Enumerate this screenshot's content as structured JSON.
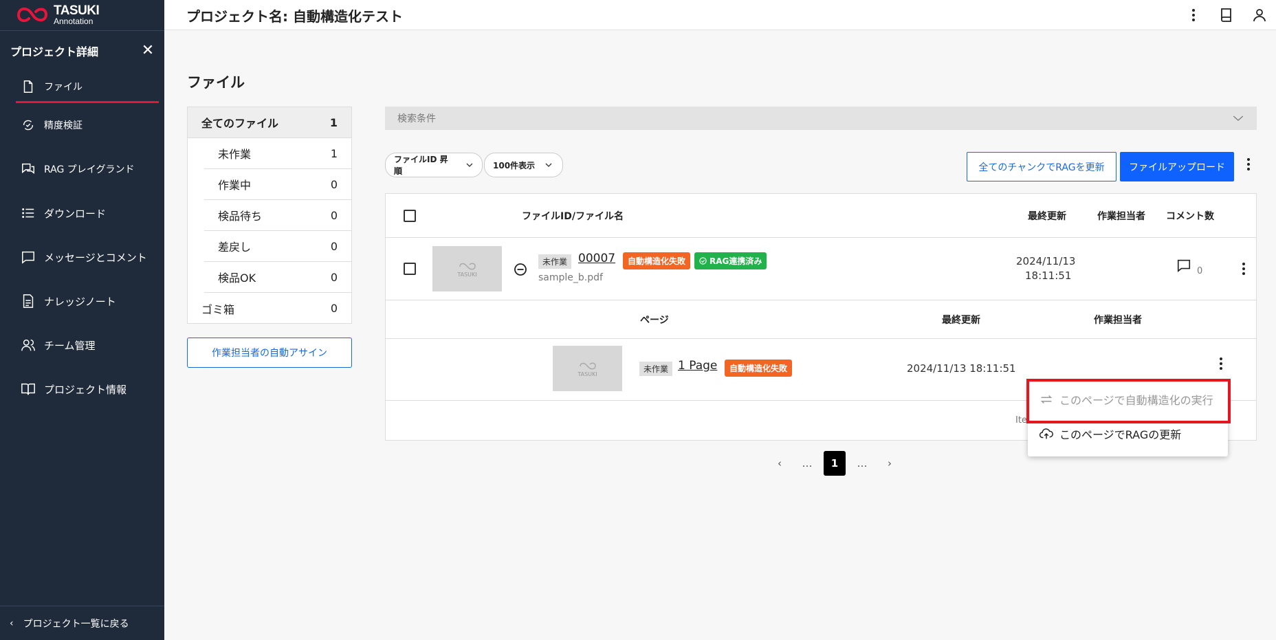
{
  "sidebar": {
    "logo_title": "TASUKI",
    "logo_sub": "Annotation",
    "header_title": "プロジェクト詳細",
    "items": [
      {
        "label": "ファイル"
      },
      {
        "label": "精度検証"
      },
      {
        "label": "RAG プレイグランド"
      },
      {
        "label": "ダウンロード"
      },
      {
        "label": "メッセージとコメント"
      },
      {
        "label": "ナレッジノート"
      },
      {
        "label": "チーム管理"
      },
      {
        "label": "プロジェクト情報"
      }
    ],
    "footer": "プロジェクト一覧に戻る"
  },
  "header": {
    "title": "プロジェクト名: 自動構造化テスト"
  },
  "main": {
    "section_title": "ファイル",
    "filters": [
      {
        "label": "全てのファイル",
        "count": "1"
      },
      {
        "label": "未作業",
        "count": "1"
      },
      {
        "label": "作業中",
        "count": "0"
      },
      {
        "label": "検品待ち",
        "count": "0"
      },
      {
        "label": "差戻し",
        "count": "0"
      },
      {
        "label": "検品OK",
        "count": "0"
      },
      {
        "label": "ゴミ箱",
        "count": "0"
      }
    ],
    "assign_button": "作業担当者の自動アサイン",
    "search_label": "検索条件",
    "sort_select": "ファイルID 昇順",
    "count_select": "100件表示",
    "rag_all_button": "全てのチャンクでRAGを更新",
    "upload_button": "ファイルアップロード",
    "table": {
      "col_name": "ファイルID/ファイル名",
      "col_updated": "最終更新",
      "col_assignee": "作業担当者",
      "col_comments": "コメント数",
      "row": {
        "status": "未作業",
        "id": "00007",
        "tag_fail": "自動構造化失敗",
        "tag_rag": "RAG連携済み",
        "filename": "sample_b.pdf",
        "date": "2024/11/13",
        "time": "18:11:51",
        "comments": "0",
        "thumb_label": "TASUKI"
      },
      "sub": {
        "col_page": "ページ",
        "col_updated": "最終更新",
        "col_assignee": "作業担当者",
        "status": "未作業",
        "page": "1 Page",
        "tag_fail": "自動構造化失敗",
        "updated": "2024/11/13 18:11:51",
        "thumb_label": "TASUKI"
      },
      "items_text": "Ite"
    },
    "pagination": {
      "prev": "‹",
      "ellipsis": "…",
      "current": "1",
      "next": "›"
    }
  },
  "context_menu": {
    "items": [
      {
        "label": "このページで自動構造化の実行",
        "disabled": true
      },
      {
        "label": "このページでRAGの更新",
        "disabled": false
      }
    ]
  }
}
